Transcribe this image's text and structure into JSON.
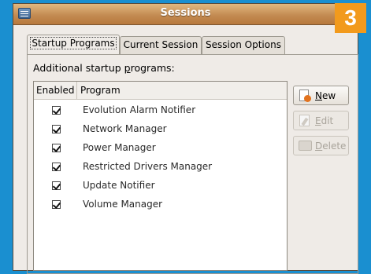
{
  "window": {
    "title": "Sessions",
    "step_badge": "3"
  },
  "tabs": [
    {
      "label": "Startup Programs",
      "active": true
    },
    {
      "label": "Current Session",
      "active": false
    },
    {
      "label": "Session Options",
      "active": false
    }
  ],
  "startup": {
    "label_prefix": "Additional startup ",
    "label_accel": "p",
    "label_suffix": "rograms:",
    "columns": {
      "enabled": "Enabled",
      "program": "Program"
    },
    "rows": [
      {
        "program": "Evolution Alarm Notifier",
        "enabled": true
      },
      {
        "program": "Network Manager",
        "enabled": true
      },
      {
        "program": "Power Manager",
        "enabled": true
      },
      {
        "program": "Restricted Drivers Manager",
        "enabled": true
      },
      {
        "program": "Update Notifier",
        "enabled": true
      },
      {
        "program": "Volume Manager",
        "enabled": true
      }
    ]
  },
  "buttons": {
    "new": {
      "accel": "N",
      "rest": "ew",
      "icon": "new-icon",
      "enabled": true
    },
    "edit": {
      "accel": "E",
      "rest": "dit",
      "icon": "edit-icon",
      "enabled": false
    },
    "delete": {
      "accel": "D",
      "rest": "elete",
      "icon": "delete-icon",
      "enabled": false
    }
  },
  "colors": {
    "background": "#1a8fd0",
    "titlebar": "#c38b52",
    "badge": "#f29a1c",
    "window": "#efebe7"
  }
}
